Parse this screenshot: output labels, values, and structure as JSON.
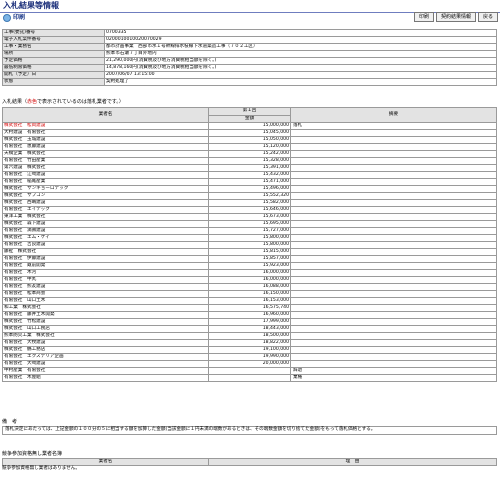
{
  "header": {
    "title": "入札結果等情報",
    "print_label": "印刷",
    "buttons": {
      "print": "印刷",
      "notice": "契約結果情報",
      "back": "戻る"
    }
  },
  "info": [
    {
      "label": "工事(委託)番号",
      "value": "0700335"
    },
    {
      "label": "電子入札案件番号",
      "value": "0200010010020070029"
    },
    {
      "label": "工事・業務名",
      "value": "都市計画事業　西部市水１号幹線排水枝線下水道築造工事（７０２工区）"
    },
    {
      "label": "場所",
      "value": "熊本市石瀬７丁目外地内"
    },
    {
      "label": "予定価格",
      "value": "21,290,000円(消費税及び地方消費税相当額を除く。)"
    },
    {
      "label": "最低制限価格",
      "value": "14,878,160円(消費税及び地方消費税相当額を除く。)"
    },
    {
      "label": "開札（予定）日",
      "value": "2007/06/07 13:15:00"
    },
    {
      "label": "状態",
      "value": "契約処理了"
    }
  ],
  "bid_caption": {
    "prefix": "入札結果（",
    "red": "赤色",
    "suffix": "で表示されているのは落札業者です。）"
  },
  "bid_table": {
    "name_header": "業者名",
    "round_header": "第１回",
    "amount_header": "金額",
    "note_header": "摘要",
    "rows": [
      {
        "name": "株式会社　松岡建設",
        "amount": "15,000,000",
        "note": "落札"
      },
      {
        "name": "大村建設　有限会社",
        "amount": "15,045,000",
        "note": ""
      },
      {
        "name": "株式会社　玉城建設",
        "amount": "15,050,000",
        "note": ""
      },
      {
        "name": "有限会社　恵藤建設",
        "amount": "15,120,000",
        "note": ""
      },
      {
        "name": "天橋企業　株式会社",
        "amount": "15,242,000",
        "note": ""
      },
      {
        "name": "有限会社　竹田産業",
        "amount": "15,328,000",
        "note": ""
      },
      {
        "name": "第六建設　株式会社",
        "amount": "15,391,000",
        "note": ""
      },
      {
        "name": "有限会社　江崎建設",
        "amount": "15,432,000",
        "note": ""
      },
      {
        "name": "有限会社　稲尾産業",
        "amount": "15,471,000",
        "note": ""
      },
      {
        "name": "株式会社　サンキョーロテック",
        "amount": "15,496,000",
        "note": ""
      },
      {
        "name": "株式会社　サブコン",
        "amount": "15,552,320",
        "note": ""
      },
      {
        "name": "株式会社　西嶋建設",
        "amount": "15,582,000",
        "note": ""
      },
      {
        "name": "有限会社　エイテック",
        "amount": "15,646,000",
        "note": ""
      },
      {
        "name": "東洋工業　株式会社",
        "amount": "15,673,000",
        "note": ""
      },
      {
        "name": "株式会社　森下建設",
        "amount": "15,695,000",
        "note": ""
      },
      {
        "name": "有限会社　満壽建設",
        "amount": "15,727,000",
        "note": ""
      },
      {
        "name": "株式会社　エム・ケイ",
        "amount": "15,800,000",
        "note": ""
      },
      {
        "name": "有限会社　吉良建設",
        "amount": "15,800,000",
        "note": ""
      },
      {
        "name": "藤祉　株式会社",
        "amount": "15,815,000",
        "note": ""
      },
      {
        "name": "有限会社　伊藤建設",
        "amount": "15,857,000",
        "note": ""
      },
      {
        "name": "有限会社　蔵前開発",
        "amount": "15,923,000",
        "note": ""
      },
      {
        "name": "有限会社　木河",
        "amount": "16,000,000",
        "note": ""
      },
      {
        "name": "有限会社　中丸",
        "amount": "16,000,000",
        "note": ""
      },
      {
        "name": "有限会社　熊友建設",
        "amount": "16,088,000",
        "note": ""
      },
      {
        "name": "有限会社　松本商会",
        "amount": "16,150,000",
        "note": ""
      },
      {
        "name": "有限会社　山口土木",
        "amount": "16,153,000",
        "note": ""
      },
      {
        "name": "和工業　株式会社",
        "amount": "16,575,740",
        "note": ""
      },
      {
        "name": "有限会社　藤井土木開発",
        "amount": "16,960,000",
        "note": ""
      },
      {
        "name": "株式会社　竹松建設",
        "amount": "17,999,000",
        "note": ""
      },
      {
        "name": "株式会社　山口工務店",
        "amount": "18,443,000",
        "note": ""
      },
      {
        "name": "熊本防災工業　株式会社",
        "amount": "18,500,000",
        "note": ""
      },
      {
        "name": "有限会社　大牧建設",
        "amount": "18,822,000",
        "note": ""
      },
      {
        "name": "株式会社　鶴工務店",
        "amount": "19,100,000",
        "note": ""
      },
      {
        "name": "有限会社　エクステリア企画",
        "amount": "19,990,000",
        "note": ""
      },
      {
        "name": "有限会社　大崎建設",
        "amount": "20,000,000",
        "note": ""
      },
      {
        "name": "中村産業　有限会社",
        "amount": "",
        "note": "辞退"
      },
      {
        "name": "有限会社　木屋組",
        "amount": "",
        "note": "棄権"
      }
    ]
  },
  "remarks": {
    "title": "備　考",
    "text": "落札決定にあたっては、上記金額の１００分の５に相当する額を加算した金額(当該金額に１円未満の端数があるときは、その端数金額を切り捨てた金額)をもって落札価格とする。"
  },
  "participation": {
    "title": "競争参加資格無し業者名簿",
    "name_header": "業者名",
    "reason_header": "理　由",
    "empty_text": "競争参加資格無し業者はありません。"
  }
}
